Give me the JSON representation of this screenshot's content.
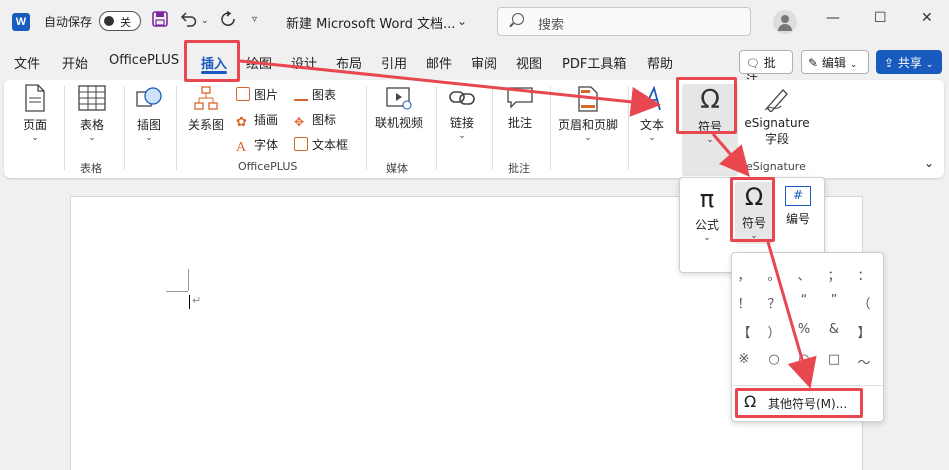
{
  "titlebar": {
    "app_logo": "W",
    "autosave_label": "自动保存",
    "autosave_state": "关",
    "doc_title": "新建 Microsoft Word 文档...",
    "search_placeholder": "搜索",
    "icons": [
      "save-icon",
      "undo-icon",
      "redo-icon",
      "customize-icon"
    ],
    "window_controls": [
      "minimize",
      "maximize",
      "close"
    ]
  },
  "tabs": [
    "文件",
    "开始",
    "OfficePLUS",
    "插入",
    "绘图",
    "设计",
    "布局",
    "引用",
    "邮件",
    "审阅",
    "视图",
    "PDF工具箱",
    "帮助"
  ],
  "active_tab": "插入",
  "right_buttons": {
    "comment": "批注",
    "edit": "编辑",
    "share": "共享"
  },
  "ribbon": {
    "page": "页面",
    "table": "表格",
    "illustration": "插图",
    "smartart": "关系图",
    "picture": "图片",
    "icon_lib": "图表",
    "insert_art": "插画",
    "icon": "图标",
    "font": "字体",
    "textbox": "文本框",
    "officeplus_group": "OfficePLUS",
    "table_group": "表格",
    "online_video": "联机视频",
    "media_group": "媒体",
    "link": "链接",
    "comment": "批注",
    "comment_group": "批注",
    "header_footer": "页眉和页脚",
    "text": "文本",
    "symbol": "符号",
    "esign_line1": "eSignature",
    "esign_line2": "字段",
    "esign_group": "eSignature"
  },
  "popup1": {
    "formula": "公式",
    "symbol": "符号",
    "number": "编号"
  },
  "popup2": {
    "symbols": [
      [
        "，",
        "。",
        "、",
        "；",
        "："
      ],
      [
        "！",
        "？",
        "“",
        "”",
        "（"
      ],
      [
        "【",
        "）",
        "%",
        "&",
        "】"
      ],
      [
        "※",
        "○",
        "○",
        "□",
        "～"
      ]
    ],
    "more_symbols": "其他符号(M)..."
  },
  "colors": {
    "accent": "#185abd",
    "highlight": "#e8474f"
  }
}
